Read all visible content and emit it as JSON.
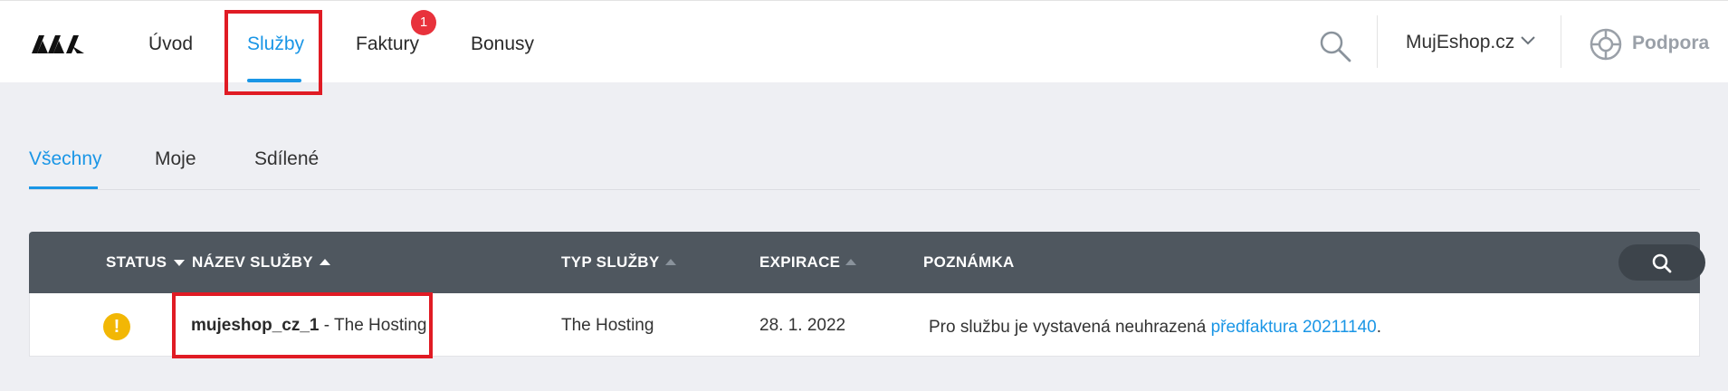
{
  "nav": {
    "items": [
      {
        "label": "Úvod"
      },
      {
        "label": "Služby",
        "active": true
      },
      {
        "label": "Faktury",
        "badge": "1"
      },
      {
        "label": "Bonusy"
      }
    ],
    "shop_select": "MujEshop.cz",
    "support_label": "Podpora",
    "icons": {
      "logo": "brand-logo",
      "search": "search-icon",
      "chevron": "chevron-down-icon",
      "support": "lifebuoy-icon"
    }
  },
  "tabs": [
    {
      "label": "Všechny",
      "active": true
    },
    {
      "label": "Moje"
    },
    {
      "label": "Sdílené"
    }
  ],
  "table": {
    "headers": {
      "status": "STATUS",
      "name": "NÁZEV SLUŽBY",
      "type": "TYP SLUŽBY",
      "expiration": "EXPIRACE",
      "note": "POZNÁMKA"
    },
    "rows": [
      {
        "status_icon": "warning-icon",
        "status_glyph": "!",
        "name_bold": "mujeshop_cz_1",
        "name_rest": " - The Hosting",
        "type": "The Hosting",
        "expiration": "28. 1. 2022",
        "note_text": "Pro službu je vystavená neuhrazená ",
        "note_link": "předfaktura 20211140",
        "note_end": "."
      }
    ]
  },
  "colors": {
    "accent": "#1a96e6",
    "header_bg": "#4f575f",
    "badge": "#e8323c",
    "warning": "#f2b705",
    "highlight": "#e01b24"
  }
}
